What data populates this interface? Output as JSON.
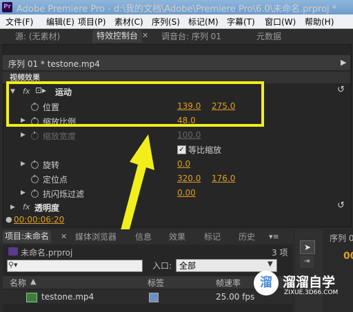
{
  "window": {
    "title": "Adobe Premiere Pro - d:\\我的文档\\Adobe\\Premiere Pro\\6.0\\未命名.prproj *",
    "app_icon": "Pr"
  },
  "menu": [
    "文件(F)",
    "编辑(E)",
    "项目(P)",
    "素材(C)",
    "序列(S)",
    "标记(M)",
    "字幕(T)",
    "窗口(W)",
    "帮助(H)"
  ],
  "top_tabs": {
    "source": "源: (无素材)",
    "effect_controls": "特效控制台",
    "audio_mixer": "调音台: 序列 01",
    "metadata": "元数据"
  },
  "effect_controls": {
    "sequence_label": "序列 01 * testone.mp4",
    "video_effects_label": "视频效果",
    "motion": {
      "name": "运动",
      "position": {
        "label": "位置",
        "x": "139.0",
        "y": "275.0"
      },
      "scale": {
        "label": "缩放比例",
        "value": "48.0"
      },
      "scale_width": {
        "label": "缩放宽度",
        "value": "100.0"
      },
      "uniform_scale": {
        "label": "等比缩放",
        "checked": true,
        "mark": "✓"
      },
      "rotation": {
        "label": "旋转",
        "value": "0.0"
      },
      "anchor": {
        "label": "定位点",
        "x": "320.0",
        "y": "176.0"
      },
      "antiflicker": {
        "label": "抗闪烁过滤",
        "value": "0.00"
      }
    },
    "opacity": {
      "name": "透明度"
    },
    "timecode": "00:00:06:20"
  },
  "bottom_tabs": {
    "project": "项目:未命名",
    "media_browser": "媒体浏览器",
    "info": "信息",
    "effects": "效果",
    "markers": "标记",
    "history": "历史",
    "menu": "▾≡"
  },
  "project": {
    "file": "未命名.prproj",
    "count": "3 项",
    "in_label": "入口:",
    "in_value": "全部",
    "columns": {
      "name": "名称",
      "label": "标签",
      "framerate": "帧速率"
    },
    "items": [
      {
        "name": "testone.mp4",
        "framerate": "25.00 fps"
      }
    ]
  },
  "right_panel": {
    "sequence_tab": "序列 01",
    "value": "00"
  },
  "watermark": {
    "logo": "溜",
    "text": "溜溜自学",
    "sub": "ZIXUE.3D66.COM"
  }
}
